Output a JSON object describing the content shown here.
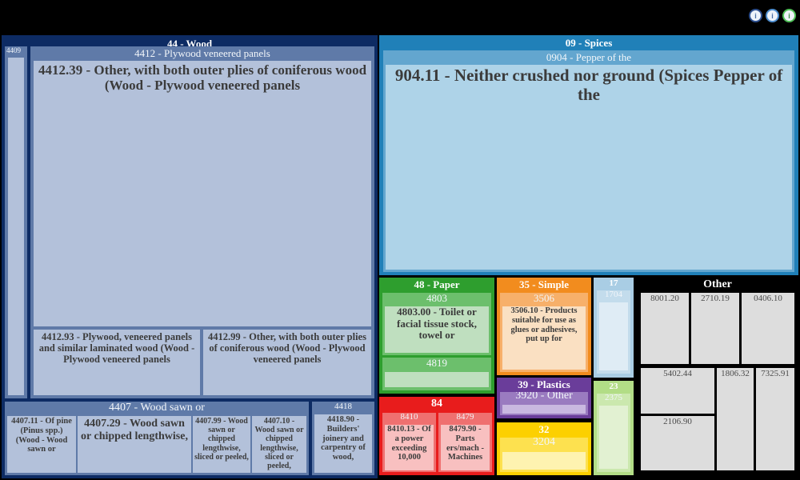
{
  "toolbar": {
    "buttons": [
      {
        "name": "info-icon",
        "glyph": "i"
      },
      {
        "name": "help-icon",
        "glyph": "i"
      },
      {
        "name": "download-icon",
        "glyph": "i"
      }
    ]
  },
  "colors": {
    "wood_dark": "#0d2b63",
    "wood_mid": "#5f7aa8",
    "wood_light": "#b3c1da",
    "spices_dark": "#2080b8",
    "spices_mid": "#63a6cf",
    "spices_light": "#aed3e8",
    "paper_dark": "#2e9e2e",
    "paper_mid": "#6cbf6c",
    "paper_light": "#bfdfbf",
    "simple_dark": "#f28c1e",
    "simple_mid": "#f7b06a",
    "simple_light": "#fae0c2",
    "plastics_dark": "#6a3d9a",
    "plastics_mid": "#9a7bc0",
    "plastics_light": "#c9b8e0",
    "yellow_dark": "#fcd000",
    "yellow_mid": "#fde14f",
    "yellow_light": "#fef3b0",
    "red_dark": "#e81c1c",
    "red_mid": "#ef7070",
    "red_light": "#f8c0c0",
    "blue17_dark": "#a9cde4",
    "blue17_mid": "#c3dcec",
    "blue17_light": "#dfecf5",
    "green23_dark": "#b2dd86",
    "green23_mid": "#cbe8ae",
    "green23_light": "#e2f1d2",
    "other_bg": "#000000",
    "other_tile": "#dddddd",
    "background": "#000000"
  },
  "treemap": {
    "type": "treemap",
    "title": "",
    "groups": [
      {
        "id": "44",
        "header": "44 - Wood",
        "children": [
          {
            "id": "4409",
            "header": "4409",
            "leaf_label": ""
          },
          {
            "id": "4412",
            "header": "4412 - Plywood veneered panels",
            "leaves": [
              "4412.39 - Other, with both outer plies of coniferous wood (Wood - Plywood veneered panels",
              "4412.93 - Plywood, veneered panels and similar laminated wood (Wood - Plywood veneered panels",
              "4412.99 - Other, with both outer plies of coniferous wood (Wood - Plywood veneered panels"
            ]
          },
          {
            "id": "4407",
            "header": "4407 - Wood sawn or",
            "leaves": [
              "4407.11 - Of pine (Pinus spp.) (Wood - Wood sawn or",
              "4407.29 - Wood sawn or chipped lengthwise,",
              "4407.99 - Wood sawn or chipped lengthwise, sliced or peeled,",
              "4407.10 - Wood sawn or chipped lengthwise, sliced or peeled,"
            ]
          },
          {
            "id": "4418",
            "header": "4418",
            "leaves": [
              "4418.90 - Builders' joinery and carpentry of wood,"
            ]
          }
        ]
      },
      {
        "id": "09",
        "header": "09 - Spices",
        "children": [
          {
            "id": "0904",
            "header": "0904 - Pepper of the",
            "leaves": [
              "904.11 - Neither crushed nor ground (Spices Pepper of the"
            ]
          }
        ]
      },
      {
        "id": "48",
        "header": "48 - Paper",
        "children": [
          {
            "id": "4803",
            "header": "4803",
            "leaves": [
              "4803.00 - Toilet or facial tissue stock, towel or"
            ]
          },
          {
            "id": "4819",
            "header": "4819",
            "leaves": [
              ""
            ]
          }
        ]
      },
      {
        "id": "35",
        "header": "35 - Simple",
        "children": [
          {
            "id": "3506",
            "header": "3506",
            "leaves": [
              "3506.10 - Products suitable for use as glues or adhesives, put up for"
            ]
          }
        ]
      },
      {
        "id": "39",
        "header": "39 - Plastics",
        "children": [
          {
            "id": "3920",
            "header": "3920 - Other",
            "leaves": [
              ""
            ]
          }
        ]
      },
      {
        "id": "32",
        "header": "32",
        "children": [
          {
            "id": "3204",
            "header": "3204",
            "leaves": [
              ""
            ]
          }
        ]
      },
      {
        "id": "84",
        "header": "84",
        "children": [
          {
            "id": "8410",
            "header": "8410",
            "leaves": [
              "8410.13 - Of a power exceeding 10,000"
            ]
          },
          {
            "id": "8479",
            "header": "8479",
            "leaves": [
              "8479.90 - Parts ers/mach - Machines"
            ]
          }
        ]
      },
      {
        "id": "17",
        "header": "17",
        "children": [
          {
            "id": "1704",
            "header": "1704",
            "leaves": [
              ""
            ]
          }
        ]
      },
      {
        "id": "23",
        "header": "23",
        "children": [
          {
            "id": "2375",
            "header": "2375",
            "leaves": [
              ""
            ]
          }
        ]
      },
      {
        "id": "other",
        "header": "Other",
        "tiles": [
          "8001.20",
          "2710.19",
          "0406.10",
          "5402.44",
          "2106.90",
          "1806.32",
          "7325.91"
        ]
      }
    ]
  }
}
